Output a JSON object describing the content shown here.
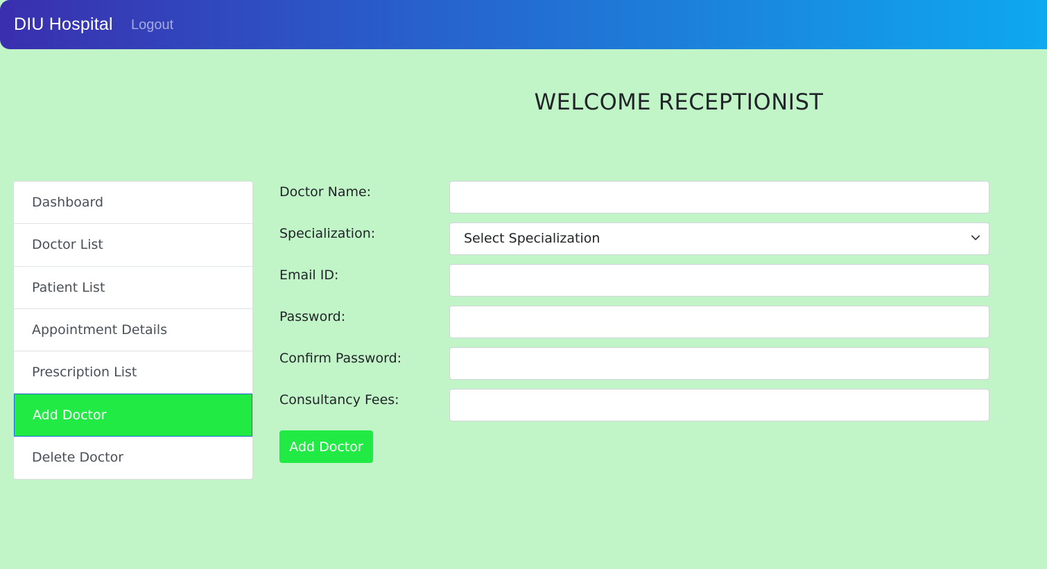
{
  "navbar": {
    "brand": "DIU Hospital",
    "logout": "Logout"
  },
  "page": {
    "title": "WELCOME RECEPTIONIST"
  },
  "sidebar": {
    "items": [
      {
        "label": "Dashboard"
      },
      {
        "label": "Doctor List"
      },
      {
        "label": "Patient List"
      },
      {
        "label": "Appointment Details"
      },
      {
        "label": "Prescription List"
      },
      {
        "label": "Add Doctor",
        "active": true
      },
      {
        "label": "Delete Doctor"
      }
    ]
  },
  "form": {
    "doctor_name": {
      "label": "Doctor Name:",
      "value": ""
    },
    "specialization": {
      "label": "Specialization:",
      "selected": "Select Specialization"
    },
    "email": {
      "label": "Email ID:",
      "value": ""
    },
    "password": {
      "label": "Password:",
      "value": ""
    },
    "confirm_password": {
      "label": "Confirm Password:",
      "value": ""
    },
    "fees": {
      "label": "Consultancy Fees:",
      "value": ""
    },
    "submit_label": "Add Doctor"
  },
  "colors": {
    "background": "#c1f5c7",
    "accent_green": "#22ea44",
    "navbar_start": "#3a2fae",
    "navbar_end": "#0ea8f0"
  }
}
